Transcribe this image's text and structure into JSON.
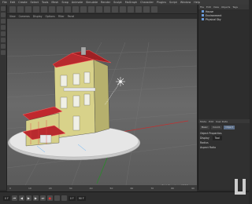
{
  "menubar": {
    "items": [
      "File",
      "Edit",
      "Create",
      "Select",
      "Tools",
      "Mesh",
      "Snap",
      "Animate",
      "Simulate",
      "Render",
      "Sculpt",
      "MoGraph",
      "Character",
      "Plugins",
      "Script",
      "Window",
      "Help"
    ]
  },
  "viewport_header": {
    "items": [
      "View",
      "Cameras",
      "Display",
      "Options",
      "Filter",
      "Panel"
    ],
    "grid_label": "Grid Spacing : 1000 cm"
  },
  "objects_panel": {
    "menu": [
      "File",
      "Edit",
      "View",
      "Objects",
      "Tags"
    ],
    "items": [
      {
        "label": "House"
      },
      {
        "label": "Environment"
      },
      {
        "label": "Physical Sky"
      }
    ]
  },
  "attributes_panel": {
    "tabs": [
      "Mode",
      "Edit",
      "User Data"
    ],
    "buttons": [
      "Basic",
      "Coord.",
      "Object"
    ],
    "rows": [
      {
        "label": "Object Properties",
        "value": ""
      },
      {
        "label": "Display",
        "value": "Tool"
      },
      {
        "label": "Radius",
        "value": ""
      },
      {
        "label": "Aspect Ratio",
        "value": ""
      }
    ]
  },
  "timeline": {
    "marks": [
      "0",
      "5",
      "10",
      "15",
      "20",
      "25",
      "30",
      "35",
      "40",
      "45",
      "50",
      "55",
      "60",
      "65",
      "70",
      "75",
      "80",
      "85",
      "90"
    ]
  },
  "transport": {
    "start": "0 F",
    "end": "90 F",
    "current": "0 F"
  },
  "colors": {
    "roof": "#c0282e",
    "walls": "#d6d089",
    "base": "#e8e8e8",
    "accent": "#5c6f8a"
  },
  "icons": [
    "move-icon",
    "scale-icon",
    "rotate-icon",
    "play-icon",
    "record-icon",
    "light-icon",
    "logo-icon"
  ]
}
